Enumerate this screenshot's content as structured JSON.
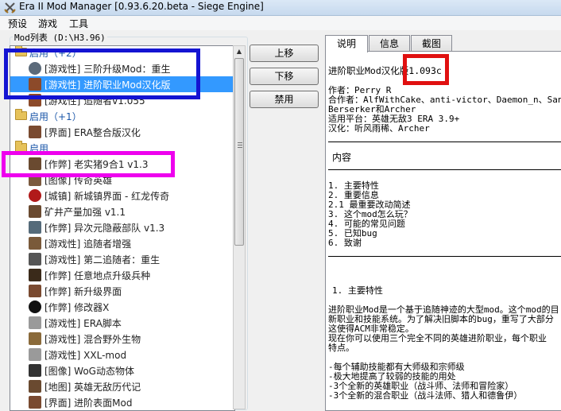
{
  "window": {
    "title": "Era II Mod Manager [0.93.6.20.beta - Siege Engine]"
  },
  "menu": [
    "预设",
    "游戏",
    "工具"
  ],
  "mod_list": {
    "label": "Mod列表 (D:\\H3.96)",
    "rows": [
      {
        "kind": "category",
        "text": "启用（+2）"
      },
      {
        "kind": "item",
        "text": "[游戏性] 三阶升级Mod：重生",
        "icon": "globe-icon",
        "color": "#5b6a7a"
      },
      {
        "kind": "item",
        "text": "[游戏性] 进阶职业Mod汉化版",
        "icon": "sword-icon",
        "color": "#8c4a2a",
        "selected": true
      },
      {
        "kind": "item",
        "text": "[游戏性] 追随者v1.055",
        "icon": "sword-icon",
        "color": "#8c4a2a"
      },
      {
        "kind": "category",
        "text": "启用（+1）"
      },
      {
        "kind": "item",
        "text": "[界面] ERA整合版汉化",
        "icon": "portrait-icon",
        "color": "#7a4a30"
      },
      {
        "kind": "category",
        "text": "启用"
      },
      {
        "kind": "item",
        "text": "[作弊] 老实猪9合1 v1.3",
        "icon": "hero-icon",
        "color": "#6a4a30"
      },
      {
        "kind": "item",
        "text": "[图像] 传奇英雄",
        "icon": "portrait-icon",
        "color": "#7b5a3e"
      },
      {
        "kind": "item",
        "text": "[城镇] 新城镇界面 - 红龙传奇",
        "icon": "red-orb-icon",
        "color": "#b11a1a"
      },
      {
        "kind": "item",
        "text": "矿井产量加强 v1.1",
        "icon": "hero-icon",
        "color": "#6a4a30"
      },
      {
        "kind": "item",
        "text": "[作弊] 异次元隐蔽部队 v1.3",
        "icon": "creature-icon",
        "color": "#556b7a"
      },
      {
        "kind": "item",
        "text": "[游戏性] 追随者增强",
        "icon": "hero-icon",
        "color": "#7a5a3a"
      },
      {
        "kind": "item",
        "text": "[游戏性] 第二追随者：重生",
        "icon": "knight-icon",
        "color": "#555555"
      },
      {
        "kind": "item",
        "text": "[作弊] 任意地点升级兵种",
        "icon": "upgrade-arrow-icon",
        "color": "#3a2a1a"
      },
      {
        "kind": "item",
        "text": "[作弊] 新升级界面",
        "icon": "portrait-icon",
        "color": "#7a4a30"
      },
      {
        "kind": "item",
        "text": "[作弊] 修改器X",
        "icon": "skull-icon",
        "color": "#111111"
      },
      {
        "kind": "item",
        "text": "[游戏性] ERA脚本",
        "icon": "folder-gray-icon",
        "color": "#9a9a9a"
      },
      {
        "kind": "item",
        "text": "[游戏性] 混合野外生物",
        "icon": "creature-icon",
        "color": "#8a6a3a"
      },
      {
        "kind": "item",
        "text": "[游戏性] XXL-mod",
        "icon": "folder-gray-icon",
        "color": "#9a9a9a"
      },
      {
        "kind": "item",
        "text": "[图像] WoG动态物体",
        "icon": "eye-icon",
        "color": "#333333"
      },
      {
        "kind": "item",
        "text": "[地图] 英雄无敌历代记",
        "icon": "hero-icon",
        "color": "#6a4a30"
      },
      {
        "kind": "item",
        "text": "[界面] 进阶表面Mod",
        "icon": "portrait-icon",
        "color": "#7a4a30"
      }
    ]
  },
  "buttons": {
    "up": "上移",
    "down": "下移",
    "disable": "禁用"
  },
  "tabs": [
    "说明",
    "信息",
    "截图"
  ],
  "description": {
    "heading_prefix": "进阶职业Mod汉化版",
    "version": "1.093c",
    "lines_a": [
      "作者：Perry R",
      "合作者：AlfWithCake、anti-victor、Daemon_n、Sandr",
      "Berserker和Archer",
      "适用平台：英雄无敌3 ERA 3.9+",
      "汉化：听风雨稀、Archer"
    ],
    "toc_title": "内容",
    "toc": [
      "1. 主要特性",
      "2. 重要信息",
      "2.1 最重要改动简述",
      "3. 这个mod怎么玩？",
      "4. 可能的常见问题",
      "5. 已知bug",
      "6. 致谢"
    ],
    "section_title": "1. 主要特性",
    "para": [
      "进阶职业Mod是一个基于追随神迹的大型mod。这个mod的目",
      "新职业和技能系统。为了解决旧脚本的bug，重写了大部分",
      "这使得ACM非常稳定。",
      "现在你可以使用三个完全不同的英雄进阶职业，每个职业",
      "特点。"
    ],
    "bullets": [
      "-每个辅助技能都有大师级和宗师级",
      "-极大地提高了较弱的技能的用处",
      "-3个全新的英雄职业（战斗师、法师和冒险家）",
      "-3个全新的混合职业（战斗法师、猎人和德鲁伊）"
    ]
  },
  "colors": {
    "highlight_blue": "#1414d2",
    "highlight_red": "#e01010",
    "highlight_magenta": "#ee00ee",
    "selection": "#3399ff"
  }
}
